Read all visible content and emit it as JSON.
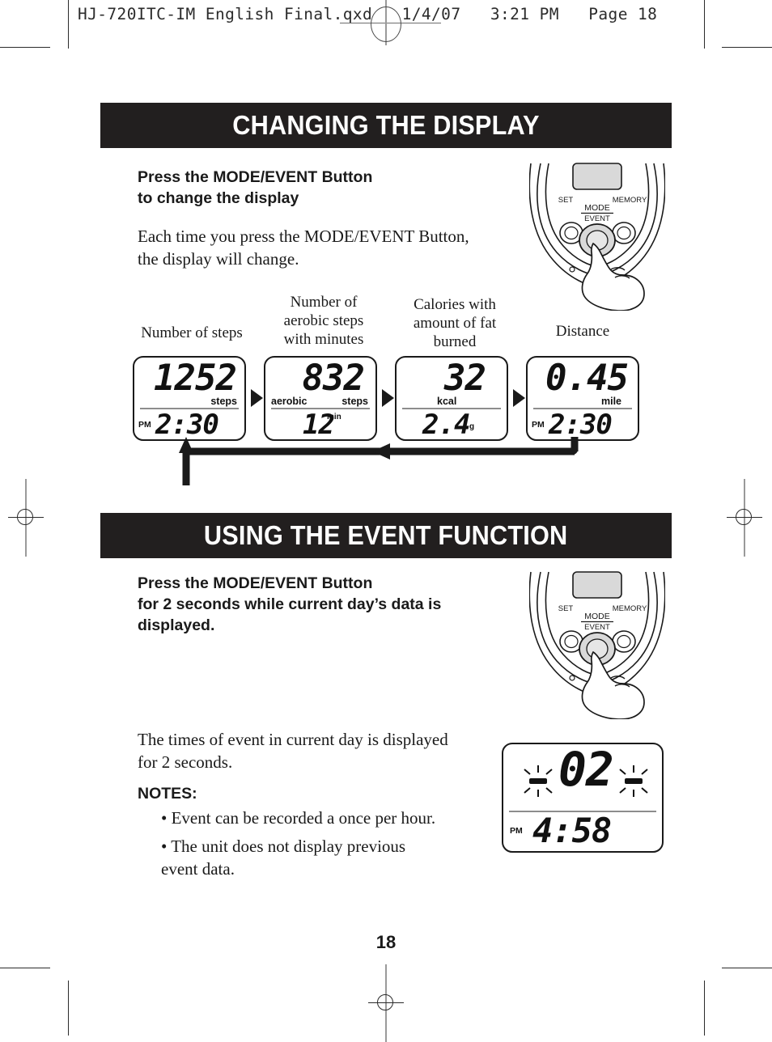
{
  "slug": {
    "text": "HJ-720ITC-IM English Final.qxd   1/4/07   3:21 PM   Page 18"
  },
  "page_number": "18",
  "sections": [
    {
      "title": "CHANGING THE DISPLAY",
      "lead": "Press the MODE/EVENT Button\nto change the display",
      "body": "Each time you press the MODE/EVENT Button,\nthe display will change."
    },
    {
      "title": "USING THE EVENT FUNCTION",
      "lead": "Press the MODE/EVENT Button\nfor 2 seconds while current day’s data is\ndisplayed.",
      "body": "The times of event in current day is displayed\nfor 2 seconds."
    }
  ],
  "device": {
    "set_label": "SET",
    "memory_label": "MEMORY",
    "mode_label": "MODE",
    "event_label": "EVENT"
  },
  "display_cycle": {
    "labels": [
      "Number of steps",
      "Number of\naerobic steps\nwith minutes",
      "Calories with\namount of fat\nburned",
      "Distance"
    ],
    "panels": [
      {
        "top_prefix": "",
        "top_value": "1252",
        "top_unit": "steps",
        "bottom_ampm": "PM",
        "bottom_value": "2:30",
        "bottom_unit": ""
      },
      {
        "top_prefix": "aerobic",
        "top_value": "832",
        "top_unit": "steps",
        "bottom_ampm": "",
        "bottom_value": "12",
        "bottom_unit": "min"
      },
      {
        "top_prefix": "",
        "top_value": "32",
        "top_unit": "kcal",
        "bottom_ampm": "",
        "bottom_value": "2.4",
        "bottom_unit": "g"
      },
      {
        "top_prefix": "",
        "top_value": "0.45",
        "top_unit": "mile",
        "bottom_ampm": "PM",
        "bottom_value": "2:30",
        "bottom_unit": ""
      }
    ]
  },
  "notes": {
    "heading": "NOTES:",
    "items": [
      "• Event can be recorded a once per hour.",
      "• The unit does not display previous\n   event data."
    ]
  },
  "event_display": {
    "count_value": "02",
    "bottom_ampm": "PM",
    "bottom_value": "4:58"
  },
  "colors": {
    "bar_bg": "#221f1f",
    "ink": "#1a1a1a",
    "lcd_divider": "#8d8d8d"
  }
}
